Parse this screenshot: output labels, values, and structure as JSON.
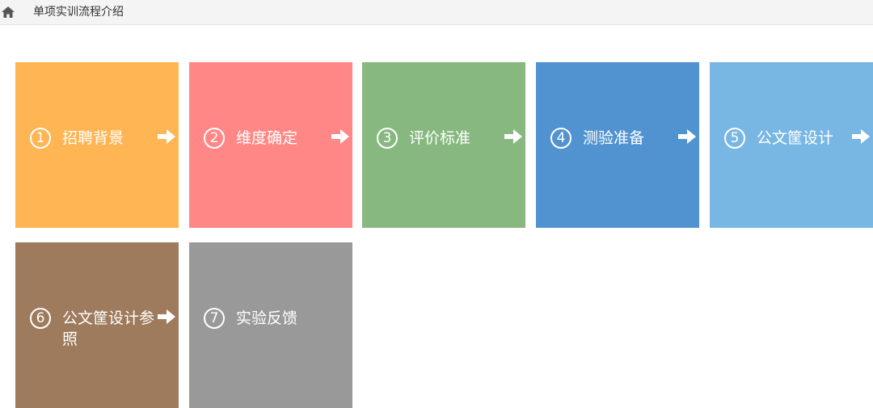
{
  "breadcrumb": {
    "icon": "home-icon",
    "title": "单项实训流程介绍"
  },
  "colors": {
    "topbar_bg": "#f4f4f4",
    "icon_color": "#555555"
  },
  "steps": [
    {
      "num": "1",
      "label": "招聘背景",
      "color": "#ffb553",
      "has_arrow": true
    },
    {
      "num": "2",
      "label": "维度确定",
      "color": "#ff8886",
      "has_arrow": true
    },
    {
      "num": "3",
      "label": "评价标准",
      "color": "#86b87f",
      "has_arrow": true
    },
    {
      "num": "4",
      "label": "测验准备",
      "color": "#5193d0",
      "has_arrow": true
    },
    {
      "num": "5",
      "label": "公文筐设计",
      "color": "#78b7e3",
      "has_arrow": true
    },
    {
      "num": "6",
      "label": "公文筐设计参照",
      "color": "#9e7b5d",
      "has_arrow": true
    },
    {
      "num": "7",
      "label": "实验反馈",
      "color": "#999999",
      "has_arrow": false
    }
  ],
  "arrow_icon": "arrow-right-icon"
}
